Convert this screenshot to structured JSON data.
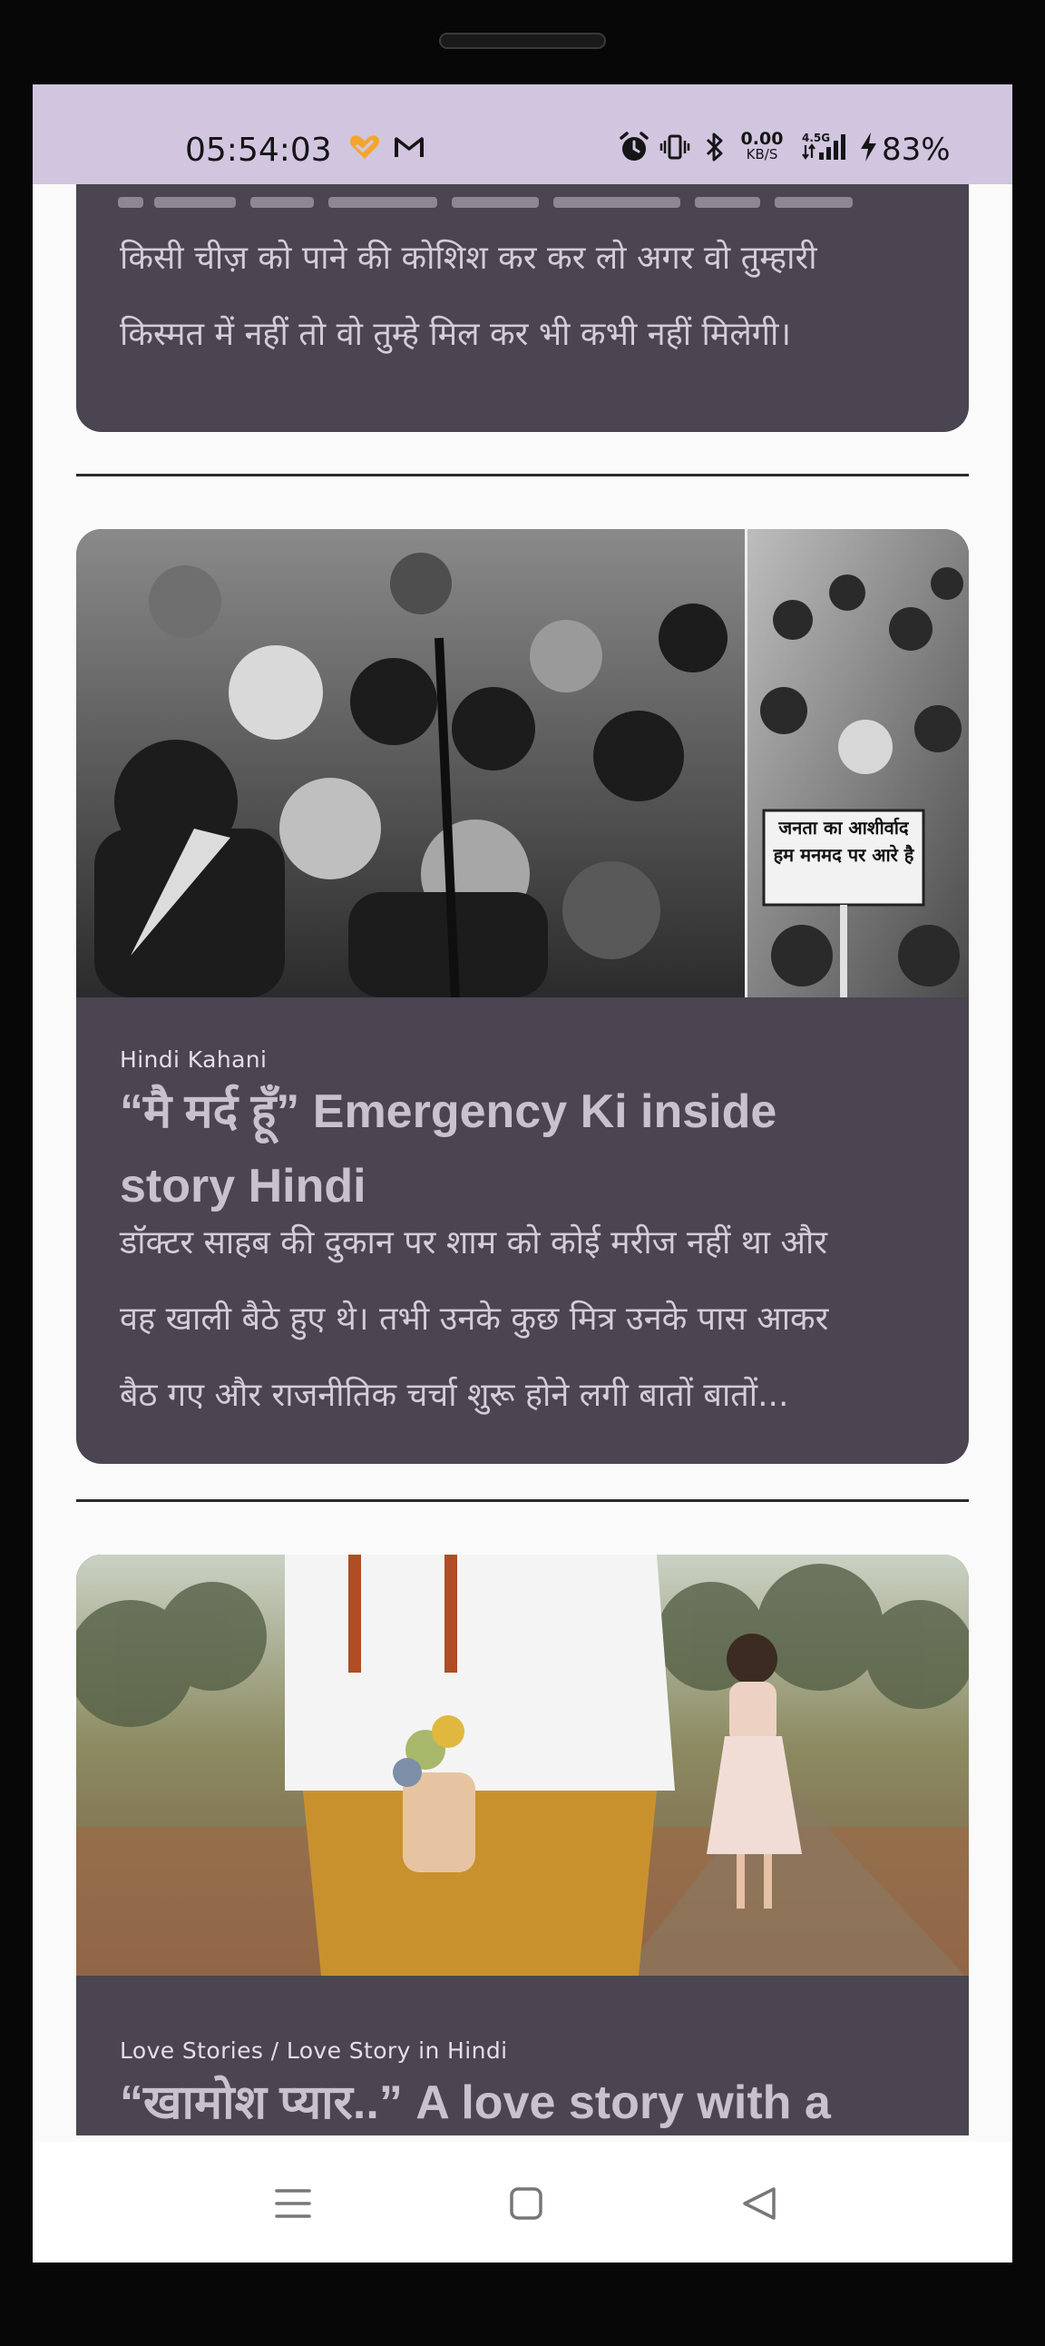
{
  "status_bar": {
    "time": "05:54:03",
    "net_speed_value": "0.00",
    "net_speed_unit": "KB/S",
    "network_type": "4.5G",
    "battery": "83%",
    "background_color": "#d1c5e0"
  },
  "feed": {
    "card1": {
      "excerpt_line1": "किसी चीज़ को पाने की कोशिश कर कर लो अगर वो तुम्हारी",
      "excerpt_line2": "किस्मत में नहीं तो वो तुम्हे मिल कर भी कभी नहीं मिलेगी।"
    },
    "card2": {
      "image_sign_text": "जनता का आशीर्वाद हम मनमद पर आरे है",
      "category": "Hindi Kahani",
      "title_line1": "“मै मर्द हूँ” Emergency Ki inside",
      "title_line2": "story Hindi",
      "excerpt_line1": "डॉक्टर साहब की दुकान पर शाम को कोई मरीज नहीं था और",
      "excerpt_line2": "वह खाली बैठे हुए थे। तभी उनके कुछ मित्र उनके पास आकर",
      "excerpt_line3": "बैठ गए और राजनीतिक चर्चा शुरू होने लगी बातों बातों..."
    },
    "card3": {
      "category": "Love Stories / Love Story in Hindi",
      "title_line1": "“खामोश प्यार..” A love story with a"
    },
    "card_color": "#4a4550"
  },
  "nav_bar": {
    "icons": [
      "menu-icon",
      "home-icon",
      "back-icon"
    ]
  }
}
